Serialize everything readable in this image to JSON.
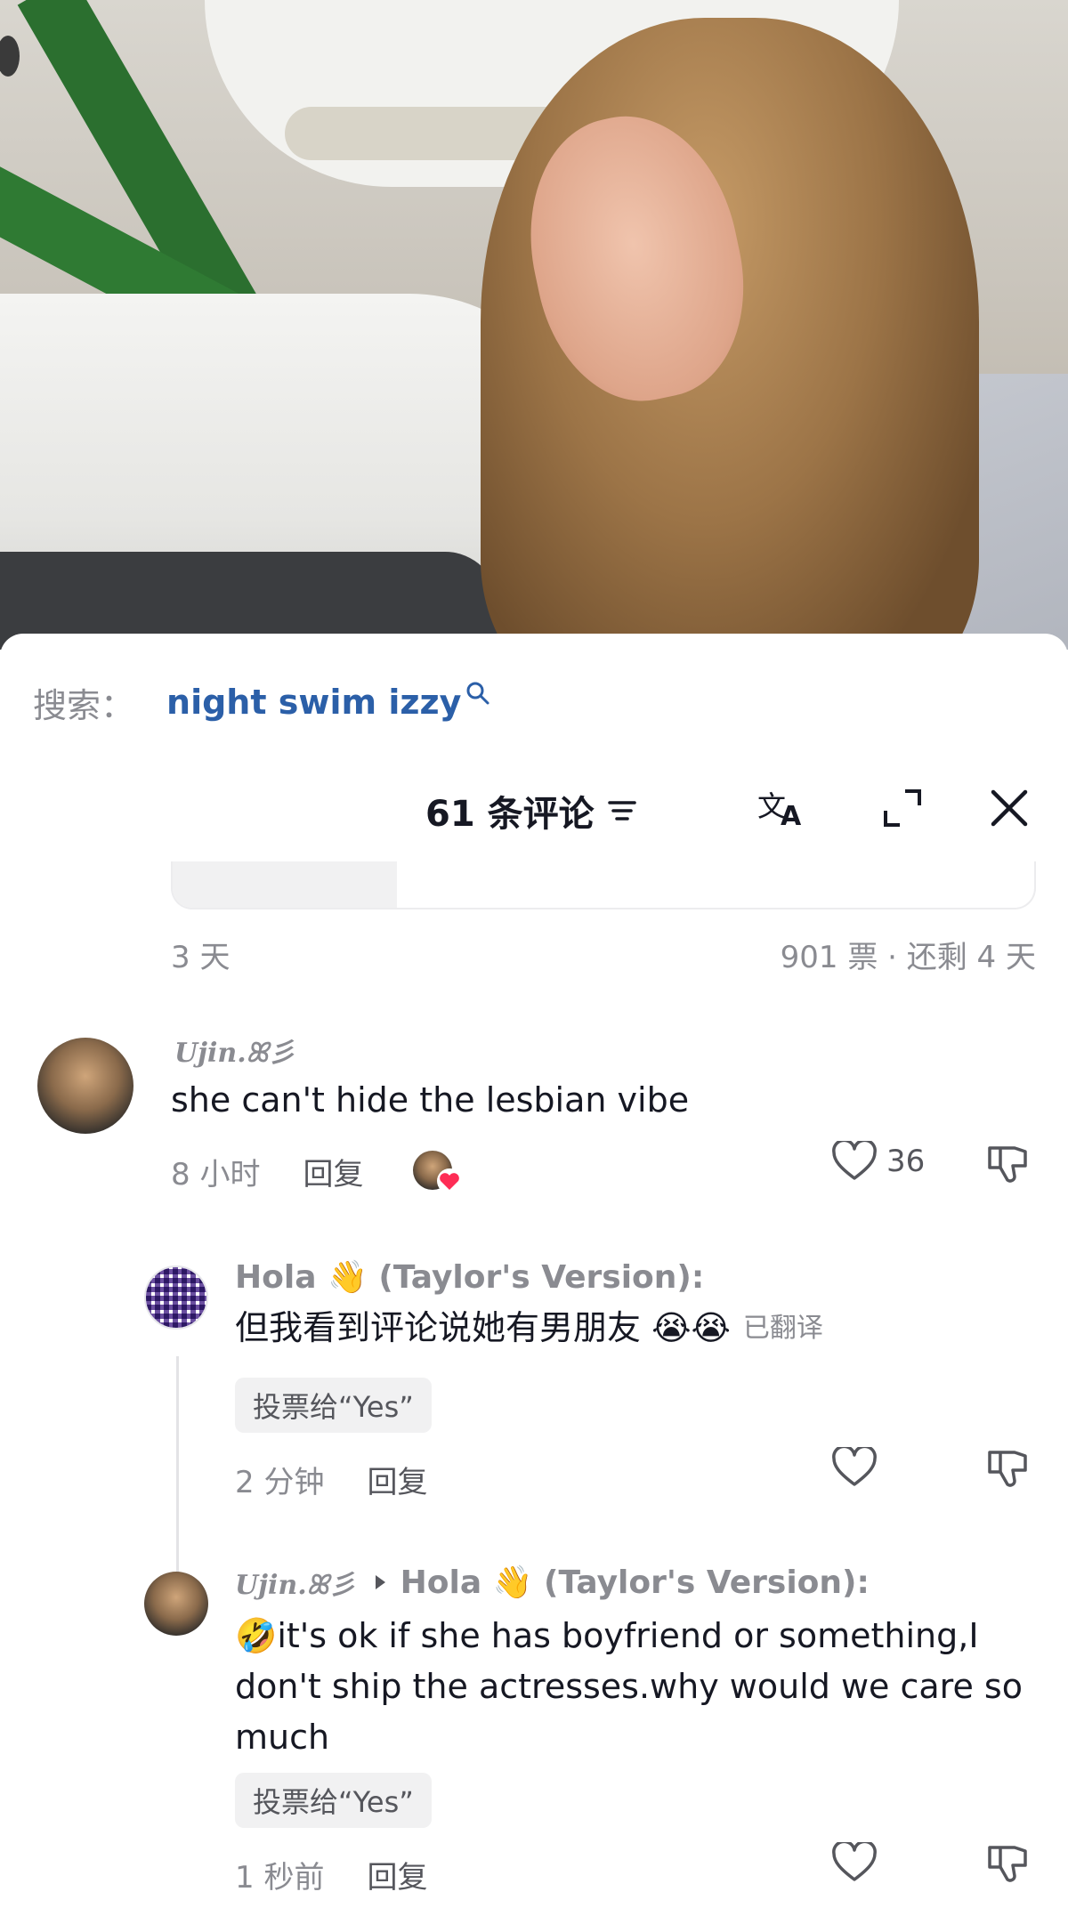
{
  "search": {
    "prefix": "搜索：",
    "term": "night swim izzy"
  },
  "header": {
    "title": "61 条评论"
  },
  "poll": {
    "age": "3 天",
    "stats": "901 票 · 还剩 4 天",
    "fill_fraction": 0.26
  },
  "comments": [
    {
      "username": "Ujin.ꕤ彡",
      "text": "she can't hide the lesbian vibe",
      "time": "8 小时",
      "reply_label": "回复",
      "likes": "36"
    },
    {
      "username": "Hola 👋 (Taylor's Version):",
      "text": "但我看到评论说她有男朋友 😭😭",
      "translated": "已翻译",
      "vote": "投票给“Yes”",
      "time": "2 分钟",
      "reply_label": "回复"
    },
    {
      "username": "Ujin.ꕤ彡",
      "reply_to": "Hola 👋 (Taylor's Version):",
      "text": "🤣it's ok if she has boyfriend or something,I don't ship the actresses.why would we care so much",
      "vote": "投票给“Yes”",
      "time": "1 秒前",
      "reply_label": "回复"
    }
  ],
  "colors": {
    "search_link": "#2b5fa8",
    "like_badge": "#fe2c55",
    "muted_text": "#8a8b91"
  }
}
